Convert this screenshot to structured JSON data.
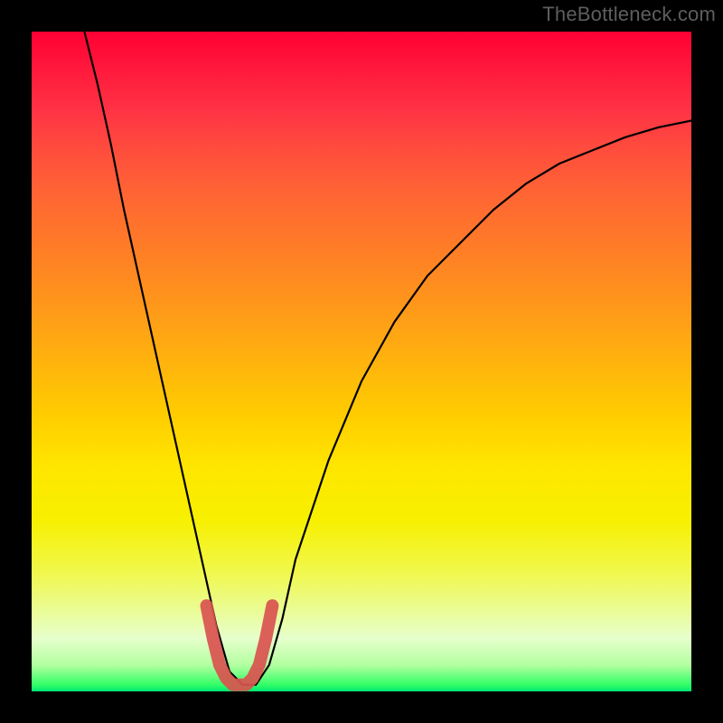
{
  "watermark": "TheBottleneck.com",
  "chart_data": {
    "type": "line",
    "title": "",
    "xlabel": "",
    "ylabel": "",
    "xlim": [
      0,
      100
    ],
    "ylim": [
      0,
      100
    ],
    "background_gradient": {
      "top": "#ff0033",
      "middle": "#ffcc00",
      "bottom": "#00e676"
    },
    "series": [
      {
        "name": "black-curve",
        "color": "#000000",
        "x": [
          8,
          10,
          12,
          14,
          16,
          18,
          20,
          22,
          24,
          26,
          28,
          30,
          32,
          34,
          36,
          38,
          40,
          45,
          50,
          55,
          60,
          65,
          70,
          75,
          80,
          85,
          90,
          95,
          100
        ],
        "y": [
          100,
          92,
          83,
          73,
          64,
          55,
          46,
          37,
          28,
          19,
          10,
          3,
          1,
          1,
          4,
          11,
          20,
          35,
          47,
          56,
          63,
          68,
          73,
          77,
          80,
          82,
          84,
          85.5,
          86.5
        ]
      },
      {
        "name": "red-marker-overlay",
        "color": "#d9534f",
        "x": [
          26.5,
          27.5,
          28.5,
          29.5,
          30.5,
          31.5,
          32.5,
          33.5,
          34.5,
          35.5,
          36.5
        ],
        "y": [
          13,
          8,
          4,
          2,
          1,
          1,
          1,
          2,
          4,
          8,
          13
        ]
      }
    ]
  }
}
